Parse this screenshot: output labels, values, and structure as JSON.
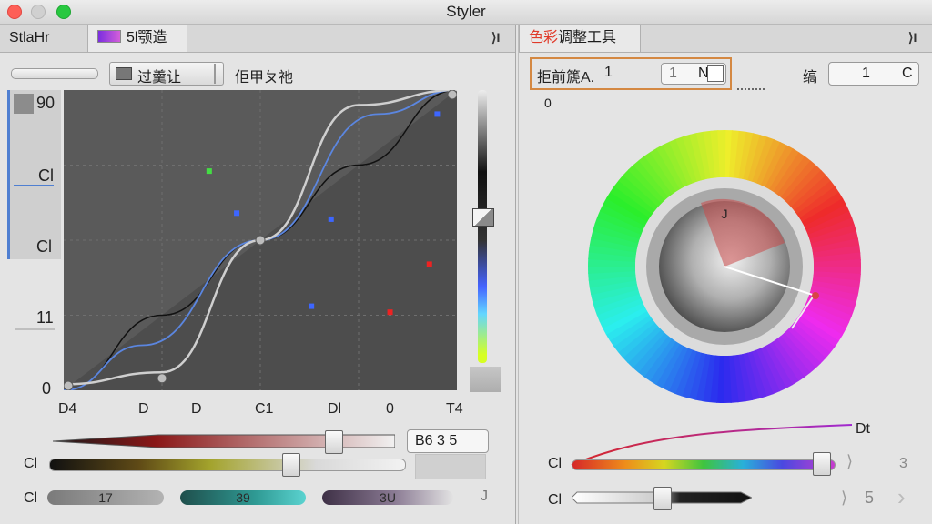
{
  "window": {
    "title": "Styler"
  },
  "left_panel": {
    "tab1_label": "StlaHr",
    "tab2_label": "5l颚造",
    "collapse_glyph": "⟩I",
    "preset_button_label": "过羹让",
    "preset_title": "佢甲ㄆ祂",
    "y_ticks": [
      "90",
      "Cl",
      "Cl",
      "11",
      "0"
    ],
    "x_ticks": [
      "D4",
      "D",
      "D",
      "C1",
      "Dl",
      "0",
      "T4"
    ],
    "slider_row1": {
      "value_text": "B6   3   5",
      "level": 0.82
    },
    "slider_row2": {
      "label": "Cl",
      "level": 0.68
    },
    "row3": {
      "label": "Cl",
      "pills": [
        "17",
        "39",
        "3U"
      ],
      "end_glyph": "J"
    }
  },
  "right_panel": {
    "tab_label_colored": "色彩",
    "tab_label": "调整工具",
    "collapse_glyph": "⟩I",
    "field1_label": "拒前篪A.",
    "field1_value": "1",
    "field1_suffix": "N",
    "field2_label": "缟",
    "field2_value": "1",
    "field2_suffix": "C",
    "zero_label": "0",
    "inner_label": "J",
    "curve_label": "Dt",
    "slider1": {
      "label": "Cl",
      "end_label": "3",
      "level": 0.95
    },
    "slider2": {
      "label": "Cl",
      "end_label": "5",
      "level": 0.5
    }
  },
  "chart_data": {
    "type": "line",
    "xlim": [
      0,
      1
    ],
    "ylim": [
      0,
      1
    ],
    "series": [
      {
        "x": [
          0,
          0.25,
          0.5,
          0.75,
          1
        ],
        "y": [
          0,
          0.25,
          0.5,
          0.75,
          1
        ]
      },
      {
        "x": [
          0,
          0.2,
          0.5,
          0.8,
          1
        ],
        "y": [
          0,
          0.15,
          0.5,
          0.92,
          1
        ]
      },
      {
        "x": [
          0,
          0.25,
          0.5,
          0.75,
          1
        ],
        "y": [
          0.02,
          0.06,
          0.5,
          0.95,
          1
        ]
      }
    ],
    "control_points": [
      [
        0,
        0
      ],
      [
        0.25,
        0.04
      ],
      [
        0.5,
        0.5
      ],
      [
        1,
        1
      ]
    ],
    "markers": [
      {
        "x": 0.37,
        "y": 0.73,
        "color": "#44dd44"
      },
      {
        "x": 0.44,
        "y": 0.59,
        "color": "#3d66ff"
      },
      {
        "x": 0.68,
        "y": 0.57,
        "color": "#3d66ff"
      },
      {
        "x": 0.95,
        "y": 0.92,
        "color": "#3d66ff"
      },
      {
        "x": 0.63,
        "y": 0.28,
        "color": "#3d66ff"
      },
      {
        "x": 0.93,
        "y": 0.42,
        "color": "#ee2222"
      },
      {
        "x": 0.83,
        "y": 0.26,
        "color": "#ee2222"
      }
    ]
  }
}
